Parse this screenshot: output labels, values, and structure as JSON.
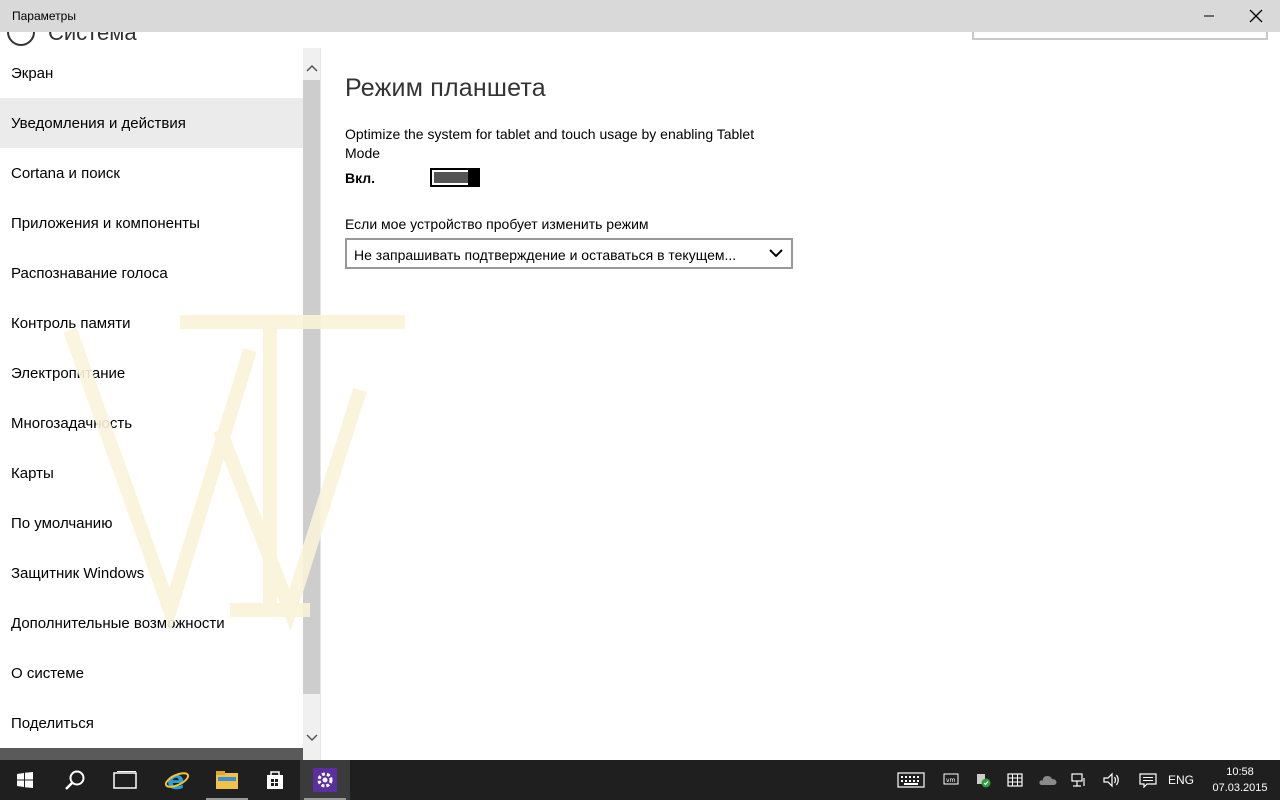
{
  "window": {
    "title": "Параметры",
    "header_partial": "Система",
    "minimize_label": "minimize",
    "close_label": "close"
  },
  "sidebar": {
    "items": [
      {
        "label": "Экран"
      },
      {
        "label": "Уведомления и действия"
      },
      {
        "label": "Cortana и поиск"
      },
      {
        "label": "Приложения и компоненты"
      },
      {
        "label": "Распознавание голоса"
      },
      {
        "label": "Контроль памяти"
      },
      {
        "label": "Электропитание"
      },
      {
        "label": "Многозадачность"
      },
      {
        "label": "Карты"
      },
      {
        "label": "По умолчанию"
      },
      {
        "label": "Защитник Windows"
      },
      {
        "label": "Дополнительные возможности"
      },
      {
        "label": "О системе"
      },
      {
        "label": "Поделиться"
      }
    ],
    "active_index": 1
  },
  "main": {
    "title": "Режим планшета",
    "description": "Optimize the system for tablet and touch usage by enabling Tablet Mode",
    "toggle": {
      "label": "Вкл.",
      "state": "on"
    },
    "dropdown": {
      "label": "Если мое устройство пробует изменить режим",
      "value": "Не запрашивать подтверждение и оставаться в текущем..."
    }
  },
  "taskbar": {
    "apps": [
      "start-icon",
      "search-icon",
      "task-view-icon",
      "internet-explorer-icon",
      "file-explorer-icon",
      "store-icon",
      "settings-icon"
    ],
    "active_app": "settings-icon",
    "tray": [
      "keyboard-icon",
      "vmware-icon",
      "defender-icon",
      "calendar-grid-icon",
      "onedrive-icon",
      "network-icon",
      "volume-icon",
      "action-center-icon"
    ],
    "language": "ENG",
    "time": "10:58",
    "date": "07.03.2015"
  },
  "colors": {
    "titlebar": "#d9d9d9",
    "taskbar": "#1f1f1f",
    "active_nav": "#ebebeb",
    "settings_accent": "#5b2fa0"
  }
}
